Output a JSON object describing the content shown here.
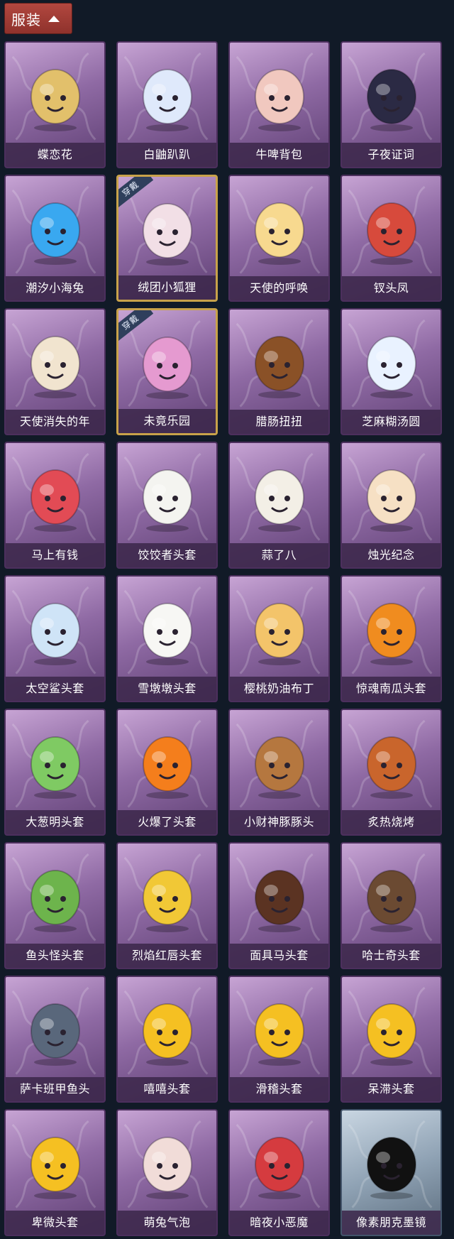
{
  "header": {
    "title": "服装"
  },
  "equipped_badge": "穿戴",
  "items": [
    {
      "label": "蝶恋花",
      "icon": "butterfly-flower-ornament-icon",
      "color": "#e2c06b",
      "equipped": false,
      "rare": false
    },
    {
      "label": "白鼬趴趴",
      "icon": "white-weasel-icon",
      "color": "#dfe9fb",
      "equipped": false,
      "rare": false
    },
    {
      "label": "牛啤背包",
      "icon": "cow-beer-backpack-icon",
      "color": "#f1c8bf",
      "equipped": false,
      "rare": false
    },
    {
      "label": "子夜证词",
      "icon": "midnight-owl-icon",
      "color": "#2b2a44",
      "equipped": false,
      "rare": false
    },
    {
      "label": "潮汐小海兔",
      "icon": "sea-rabbit-icon",
      "color": "#39a8f0",
      "equipped": false,
      "rare": false
    },
    {
      "label": "绒团小狐狸",
      "icon": "fluffy-fox-icon",
      "color": "#f2dfe6",
      "equipped": true,
      "rare": false
    },
    {
      "label": "天使的呼唤",
      "icon": "angel-doll-icon",
      "color": "#f7d98f",
      "equipped": false,
      "rare": false
    },
    {
      "label": "钗头凤",
      "icon": "phoenix-crown-icon",
      "color": "#d74a3c",
      "equipped": false,
      "rare": false
    },
    {
      "label": "天使消失的年",
      "icon": "veiled-angel-icon",
      "color": "#f1e4cf",
      "equipped": false,
      "rare": false
    },
    {
      "label": "未竟乐园",
      "icon": "pink-hair-girl-icon",
      "color": "#e59ad0",
      "equipped": true,
      "rare": false
    },
    {
      "label": "腊肠扭扭",
      "icon": "dachshund-icon",
      "color": "#8a5127",
      "equipped": false,
      "rare": false
    },
    {
      "label": "芝麻糊汤圆",
      "icon": "rice-ball-icon",
      "color": "#e9f2ff",
      "equipped": false,
      "rare": false
    },
    {
      "label": "马上有钱",
      "icon": "red-horse-icon",
      "color": "#e24b55",
      "equipped": false,
      "rare": false
    },
    {
      "label": "饺饺者头套",
      "icon": "dumpling-head-icon",
      "color": "#f4f4f0",
      "equipped": false,
      "rare": false
    },
    {
      "label": "蒜了八",
      "icon": "garlic-icon",
      "color": "#f3efe6",
      "equipped": false,
      "rare": false
    },
    {
      "label": "烛光纪念",
      "icon": "candle-icon",
      "color": "#f6e0c4",
      "equipped": false,
      "rare": false
    },
    {
      "label": "太空鲨头套",
      "icon": "shark-head-icon",
      "color": "#cfe4f7",
      "equipped": false,
      "rare": false
    },
    {
      "label": "雪墩墩头套",
      "icon": "snowman-head-icon",
      "color": "#f7f7f4",
      "equipped": false,
      "rare": false
    },
    {
      "label": "樱桃奶油布丁",
      "icon": "pudding-icon",
      "color": "#f3c46a",
      "equipped": false,
      "rare": false
    },
    {
      "label": "惊魂南瓜头套",
      "icon": "pumpkin-icon",
      "color": "#f08c1f",
      "equipped": false,
      "rare": false
    },
    {
      "label": "大葱明头套",
      "icon": "scallion-icon",
      "color": "#7fca63",
      "equipped": false,
      "rare": false
    },
    {
      "label": "火爆了头套",
      "icon": "fire-head-icon",
      "color": "#f47e1c",
      "equipped": false,
      "rare": false
    },
    {
      "label": "小财神豚豚头",
      "icon": "capybara-icon",
      "color": "#b5773f",
      "equipped": false,
      "rare": false
    },
    {
      "label": "炙热烧烤",
      "icon": "bbq-meat-icon",
      "color": "#c9652c",
      "equipped": false,
      "rare": false
    },
    {
      "label": "鱼头怪头套",
      "icon": "fish-head-icon",
      "color": "#6db44c",
      "equipped": false,
      "rare": false
    },
    {
      "label": "烈焰红唇头套",
      "icon": "pikachu-head-icon",
      "color": "#f1c836",
      "equipped": false,
      "rare": false
    },
    {
      "label": "面具马头套",
      "icon": "horse-mask-icon",
      "color": "#5b3322",
      "equipped": false,
      "rare": false
    },
    {
      "label": "哈士奇头套",
      "icon": "husky-head-icon",
      "color": "#6b4a32",
      "equipped": false,
      "rare": false
    },
    {
      "label": "萨卡班甲鱼头",
      "icon": "sacabambaspis-icon",
      "color": "#59677b",
      "equipped": false,
      "rare": false
    },
    {
      "label": "嘻嘻头套",
      "icon": "grin-emoji-icon",
      "color": "#f5c022",
      "equipped": false,
      "rare": false
    },
    {
      "label": "滑稽头套",
      "icon": "smirk-emoji-icon",
      "color": "#f5c022",
      "equipped": false,
      "rare": false
    },
    {
      "label": "呆滞头套",
      "icon": "dazed-emoji-icon",
      "color": "#f5c022",
      "equipped": false,
      "rare": false
    },
    {
      "label": "卑微头套",
      "icon": "humble-emoji-icon",
      "color": "#f5c022",
      "equipped": false,
      "rare": false
    },
    {
      "label": "萌兔气泡",
      "icon": "bunny-bubble-icon",
      "color": "#f1dcd8",
      "equipped": false,
      "rare": false
    },
    {
      "label": "暗夜小恶魔",
      "icon": "night-devil-icon",
      "color": "#d53b3f",
      "equipped": false,
      "rare": false
    },
    {
      "label": "像素朋克墨镜",
      "icon": "pixel-sunglasses-icon",
      "color": "#111111",
      "equipped": false,
      "rare": true
    }
  ]
}
